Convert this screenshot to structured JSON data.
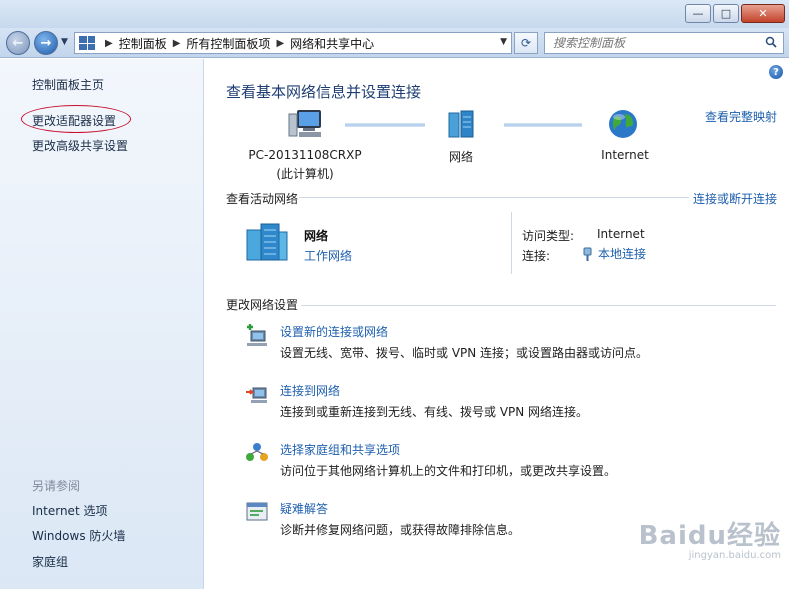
{
  "window": {
    "minimize": "—",
    "maximize": "□",
    "close": "✕"
  },
  "nav": {
    "breadcrumbs": [
      "控制面板",
      "所有控制面板项",
      "网络和共享中心"
    ],
    "search_placeholder": "搜索控制面板"
  },
  "sidebar": {
    "home": "控制面板主页",
    "adapter": "更改适配器设置",
    "advanced": "更改高级共享设置",
    "see_also": "另请参阅",
    "links": [
      "Internet 选项",
      "Windows 防火墙",
      "家庭组"
    ]
  },
  "main": {
    "title": "查看基本网络信息并设置连接",
    "full_map": "查看完整映射",
    "map": {
      "pc_name": "PC-20131108CRXP",
      "pc_sub": "(此计算机)",
      "network": "网络",
      "internet": "Internet"
    },
    "active": {
      "heading": "查看活动网络",
      "connect_link": "连接或断开连接",
      "name": "网络",
      "type": "工作网络",
      "access_label": "访问类型:",
      "access_value": "Internet",
      "connection_label": "连接:",
      "connection_value": "本地连接"
    },
    "change": {
      "heading": "更改网络设置",
      "tasks": [
        {
          "title": "设置新的连接或网络",
          "desc": "设置无线、宽带、拨号、临时或 VPN 连接；或设置路由器或访问点。"
        },
        {
          "title": "连接到网络",
          "desc": "连接到或重新连接到无线、有线、拨号或 VPN 网络连接。"
        },
        {
          "title": "选择家庭组和共享选项",
          "desc": "访问位于其他网络计算机上的文件和打印机，或更改共享设置。"
        },
        {
          "title": "疑难解答",
          "desc": "诊断并修复网络问题，或获得故障排除信息。"
        }
      ]
    },
    "help": "?"
  },
  "watermark": {
    "main": "Baidu经验",
    "sub": "jingyan.baidu.com"
  }
}
